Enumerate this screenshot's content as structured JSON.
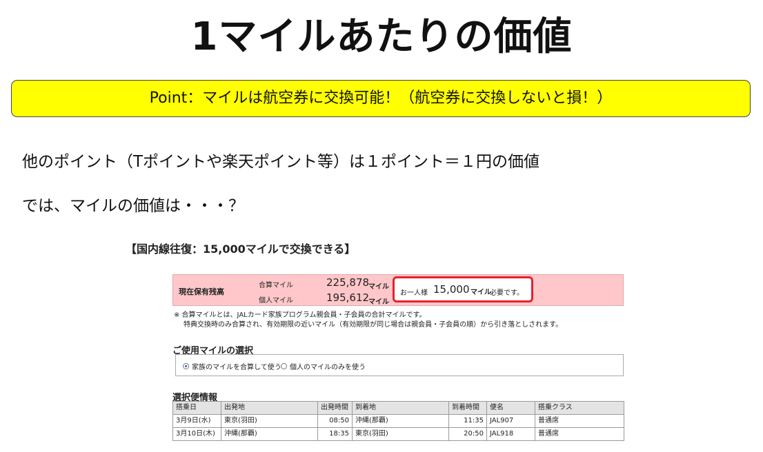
{
  "title": "1マイルあたりの価値",
  "point": "Point：マイルは航空券に交換可能！（航空券に交換しないと損！）",
  "lines": [
    "他のポイント（Tポイントや楽天ポイント等）は１ポイント＝１円の価値",
    "では、マイルの価値は・・・？"
  ],
  "screenshot": {
    "title": "【国内線往復：15,000マイルで交換できる】",
    "miles": {
      "header": "現在保有残高",
      "total_label": "合算マイル",
      "total_value": "225,878",
      "personal_label": "個人マイル",
      "personal_value": "195,612",
      "unit": "マイル",
      "need_prefix": "お一人様",
      "need_value": "15,000",
      "need_unit": "マイル",
      "need_suffix": "必要です。"
    },
    "notes": [
      "※ 合算マイルとは、JALカード家族プログラム親会員・子会員の合計マイルです。",
      "特典交換時のみ合算され、有効期限の近いマイル（有効期限が同じ場合は親会員・子会員の順）から引き落としされます。"
    ],
    "mile_selection": {
      "heading": "ご使用マイルの選択",
      "options": [
        "家族のマイルを合算して使う",
        "個人のマイルのみを使う"
      ],
      "selected": 0
    },
    "flights": {
      "heading": "選択便情報",
      "columns": [
        "搭乗日",
        "出発地",
        "出発時間",
        "到着地",
        "到着時間",
        "便名",
        "搭乗クラス"
      ],
      "rows": [
        [
          "3月9日(水)",
          "東京(羽田)",
          "08:50",
          "沖縄(那覇)",
          "11:35",
          "JAL907",
          "普通席"
        ],
        [
          "3月10日(木)",
          "沖縄(那覇)",
          "18:35",
          "東京(羽田)",
          "20:50",
          "JAL918",
          "普通席"
        ]
      ]
    }
  },
  "colors": {
    "highlight": "#ffff00",
    "miles_bg": "#ffc7c9",
    "need_border": "#e8202c"
  }
}
